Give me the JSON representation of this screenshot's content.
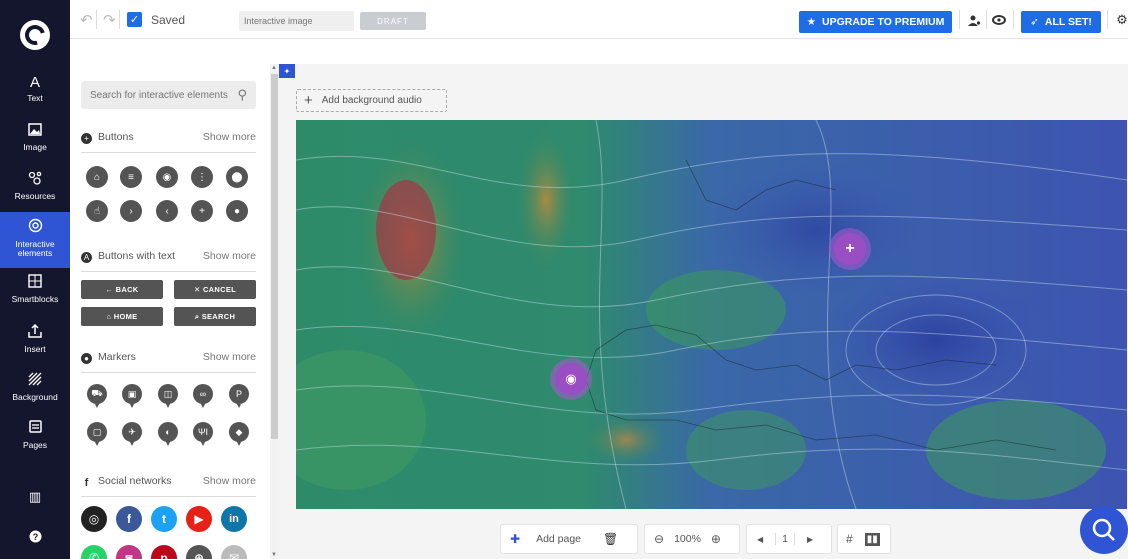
{
  "topbar": {
    "saved_label": "Saved",
    "title_placeholder": "Interactive image",
    "draft_label": "DRAFT",
    "upgrade_label": "UPGRADE TO PREMIUM",
    "allset_label": "ALL SET!"
  },
  "nav": {
    "items": [
      {
        "label": "Text",
        "icon": "text-icon",
        "glyph": "A"
      },
      {
        "label": "Image",
        "icon": "image-icon",
        "glyph": "▨"
      },
      {
        "label": "Resources",
        "icon": "resources-icon",
        "glyph": "❖"
      },
      {
        "label": "Interactive elements",
        "icon": "interactive-icon",
        "glyph": "◎",
        "active": true
      },
      {
        "label": "Smartblocks",
        "icon": "smartblocks-icon",
        "glyph": "▦"
      },
      {
        "label": "Insert",
        "icon": "insert-icon",
        "glyph": "⇪"
      },
      {
        "label": "Background",
        "icon": "background-icon",
        "glyph": "▥"
      },
      {
        "label": "Pages",
        "icon": "pages-icon",
        "glyph": "▤"
      }
    ]
  },
  "panel": {
    "search_placeholder": "Search for interactive elements",
    "sections": {
      "buttons": {
        "title": "Buttons",
        "more": "Show more"
      },
      "buttons_text": {
        "title": "Buttons with text",
        "more": "Show more"
      },
      "markers": {
        "title": "Markers",
        "more": "Show more"
      },
      "social": {
        "title": "Social networks",
        "more": "Show more"
      }
    },
    "text_buttons": [
      "← BACK",
      "✕ CANCEL",
      "⌂ HOME",
      "⌕ SEARCH"
    ]
  },
  "canvas": {
    "bg_audio_label": "Add background audio",
    "colors": {
      "accent": "#2f55d4",
      "hotspot": "#9a4ec4",
      "nav_bg": "#14162d",
      "brand_blue": "#1e6de6"
    }
  },
  "bottom": {
    "add_page_label": "Add page",
    "zoom_label": "100%",
    "page_number": "1"
  }
}
